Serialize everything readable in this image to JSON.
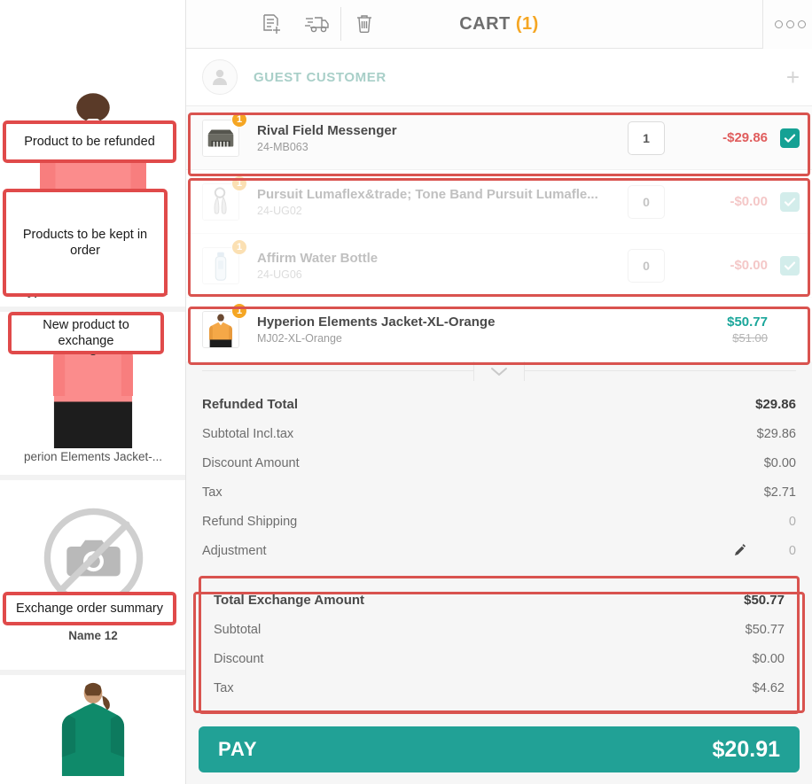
{
  "header": {
    "title": "CART",
    "count": "(1)",
    "icons": [
      {
        "name": "new-order-icon",
        "label": "New Order"
      },
      {
        "name": "shipping-truck-icon",
        "label": "Shipping"
      },
      {
        "name": "trash-icon",
        "label": "Delete Cart"
      }
    ],
    "more_label": "More Options"
  },
  "customer": {
    "name": "GUEST CUSTOMER",
    "add_label": "+"
  },
  "cart_items": [
    {
      "name": "Rival Field Messenger",
      "sku": "24-MB063",
      "badge": "1",
      "qty": "1",
      "price": "-$29.86",
      "old_price": "",
      "price_kind": "neg",
      "checked": true,
      "faded": false,
      "thumb": "messenger-bag"
    },
    {
      "name": "Pursuit Lumaflex&trade; Tone Band Pursuit Lumafle...",
      "sku": "24-UG02",
      "badge": "1",
      "qty": "0",
      "price": "-$0.00",
      "old_price": "",
      "price_kind": "neg",
      "checked": true,
      "faded": true,
      "thumb": "tone-band"
    },
    {
      "name": "Affirm Water Bottle",
      "sku": "24-UG06",
      "badge": "1",
      "qty": "0",
      "price": "-$0.00",
      "old_price": "",
      "price_kind": "neg",
      "checked": true,
      "faded": true,
      "thumb": "water-bottle"
    },
    {
      "name": "Hyperion Elements Jacket-XL-Orange",
      "sku": "MJ02-XL-Orange",
      "badge": "1",
      "qty": "",
      "price": "$50.77",
      "old_price": "$51.00",
      "price_kind": "pos",
      "checked": false,
      "faded": false,
      "thumb": "orange-jacket"
    }
  ],
  "refund_totals": {
    "title": "Refunded Total",
    "title_value": "$29.86",
    "rows": [
      {
        "label": "Subtotal Incl.tax",
        "value": "$29.86",
        "muted": false,
        "edit": false
      },
      {
        "label": "Discount Amount",
        "value": "$0.00",
        "muted": false,
        "edit": false
      },
      {
        "label": "Tax",
        "value": "$2.71",
        "muted": false,
        "edit": false
      },
      {
        "label": "Refund Shipping",
        "value": "0",
        "muted": true,
        "edit": false
      },
      {
        "label": "Adjustment",
        "value": "0",
        "muted": true,
        "edit": true
      }
    ]
  },
  "exchange_totals": {
    "title": "Total Exchange Amount",
    "title_value": "$50.77",
    "rows": [
      {
        "label": "Subtotal",
        "value": "$50.77"
      },
      {
        "label": "Discount",
        "value": "$0.00"
      },
      {
        "label": "Tax",
        "value": "$4.62"
      }
    ]
  },
  "pay": {
    "label": "PAY",
    "amount": "$20.91"
  },
  "left_panel": {
    "products": [
      {
        "name": "Hyperion Elements Jacket",
        "kind": "pink-jacket"
      },
      {
        "name": "perion Elements Jacket-...",
        "kind": "pink-jacket"
      },
      {
        "name": "Name 12",
        "kind": "no-image"
      },
      {
        "name": "",
        "kind": "green-top"
      }
    ]
  },
  "annotations": [
    {
      "id": "anno-refund",
      "text": "Product to be refunded"
    },
    {
      "id": "anno-keep",
      "text": "Products to be kept in order"
    },
    {
      "id": "anno-exchange",
      "text": "New product to exchange"
    },
    {
      "id": "anno-summary",
      "text": "Exchange order summary"
    }
  ],
  "colors": {
    "accent_teal": "#21a196",
    "badge_orange": "#f5a623",
    "annotation_red": "#d9534f",
    "negative_red": "#e05d5d",
    "title_gray": "#6e6e6e"
  }
}
